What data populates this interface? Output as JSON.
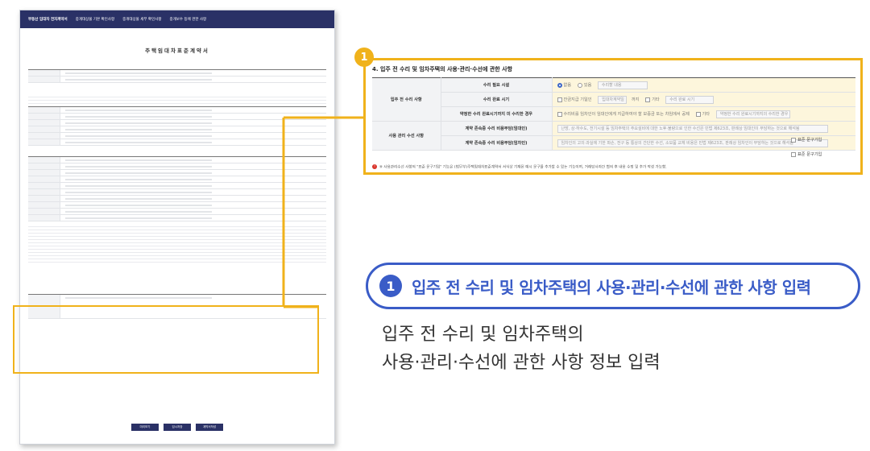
{
  "thumbnail": {
    "tabs": [
      "부동산 임대차 전자계약서",
      "중개대상물 기본 확인사항",
      "중개대상물 세부 확인사항",
      "중개보수 등에 관한 사항"
    ],
    "title": "주택임대차표준계약서",
    "buttons": [
      "미리보기",
      "임시저장",
      "계약서작성"
    ]
  },
  "zoom": {
    "badge": "1",
    "title": "4. 입주 전 수리 및 임차주택의 사용·관리·수선에 관한 사항",
    "group_before": "입주 전 수리 사항",
    "group_use": "사용 관리 수선 사항",
    "row1": {
      "label": "수리 필요 시설",
      "opt_none": "없음",
      "opt_yes": "있음",
      "field": "수리할 내용"
    },
    "row2": {
      "label": "수리 완료 시기",
      "chk_text": "잔금지급 기일인",
      "field1": "입대차계약일",
      "until": "까지",
      "etc": "기타",
      "field2": "수리 완료 시기"
    },
    "row3": {
      "label": "약정한 수리 완료시기까지 미 수리한 경우",
      "text": "수리비를 임차인이 임대인에게 지급하여야 할 보증금 또는 차임에서 공제",
      "etc": "기타",
      "field": "약정한 수리 완료시기까지의 수리한 경우"
    },
    "row4": {
      "label": "계약 존속중 수리 비용부담(임대인)",
      "field": "난방, 상·하수도, 전기시설 등 임차주택의 주요설비에 대한 노후·불량으로 인한 수선은 민법 제623조, 판례상 임대인이 부담하는 것으로 해석됨",
      "chk": "표준 문구기입"
    },
    "row5": {
      "label": "계약 존속중 수리 비용부담(임차인)",
      "field": "임차인의 고의·과실에 기한 파손, 전구 등 통상의 간단한 수선, 소모품 교체 비용은 민법 제623조, 판례상 임차인이 부담하는 것으로 해석됨",
      "chk": "표준 문구기입"
    },
    "footnote": "※ 사용관리수선 사항의 \"표준 문구기입\" 기능은 (법무부)주택임대차표준계약서 서식상 기재된 예시 문구를 추가할 수 있는 기능이며, 거래당사자간 협의 후 내용 수정 및 추가 작성 가능함."
  },
  "callout": {
    "number": "1",
    "text": "입주 전 수리 및 임차주택의 사용·관리·수선에 관한 사항 입력"
  },
  "description": {
    "line1": "입주 전 수리 및 임차주택의",
    "line2": "사용·관리·수선에 관한 사항 정보 입력"
  },
  "colors": {
    "highlight": "#f0b21b",
    "accent": "#3a5cc7",
    "header_bar": "#2a3166",
    "field_bg": "#fdf6dc"
  }
}
